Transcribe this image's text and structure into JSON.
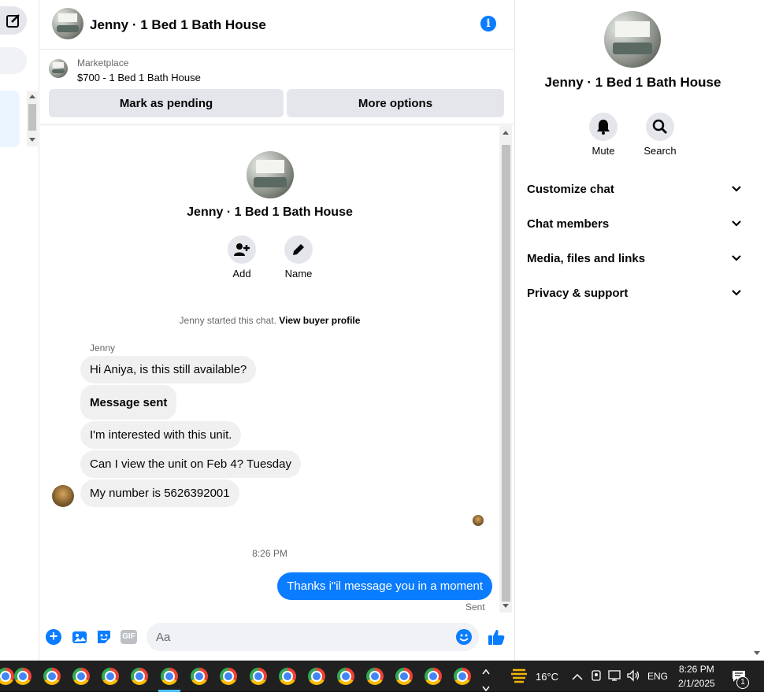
{
  "conversation": {
    "title": "Jenny · 1 Bed 1 Bath House"
  },
  "listing": {
    "source": "Marketplace",
    "summary": "$700 - 1 Bed 1 Bath House",
    "mark_pending_label": "Mark as pending",
    "more_options_label": "More options"
  },
  "intro": {
    "name": "Jenny · 1 Bed 1 Bath House",
    "add_label": "Add",
    "name_label": "Name",
    "started_text": "Jenny started this chat.",
    "buyer_profile_link": "View buyer profile"
  },
  "messages": {
    "sender": "Jenny",
    "incoming": [
      "Hi Aniya, is this still available?",
      "Message sent",
      "I'm interested with this unit.",
      "Can I view the unit on Feb 4? Tuesday",
      "My number is 5626392001"
    ],
    "timestamp": "8:26 PM",
    "outgoing": "Thanks i\"il message you in a moment",
    "status": "Sent"
  },
  "composer": {
    "placeholder": "Aa",
    "gif_label": "GIF"
  },
  "details": {
    "name": "Jenny · 1 Bed 1 Bath House",
    "mute_label": "Mute",
    "search_label": "Search",
    "sections": [
      "Customize chat",
      "Chat members",
      "Media, files and links",
      "Privacy & support"
    ]
  },
  "taskbar": {
    "temperature": "16°C",
    "language": "ENG",
    "time": "8:26 PM",
    "date": "2/1/2025",
    "notification_count": "1"
  },
  "colors": {
    "accent": "#0a7cff",
    "bubble_in": "#f0f0f0",
    "button_bg": "#e4e6eb",
    "taskbar": "#202020"
  }
}
